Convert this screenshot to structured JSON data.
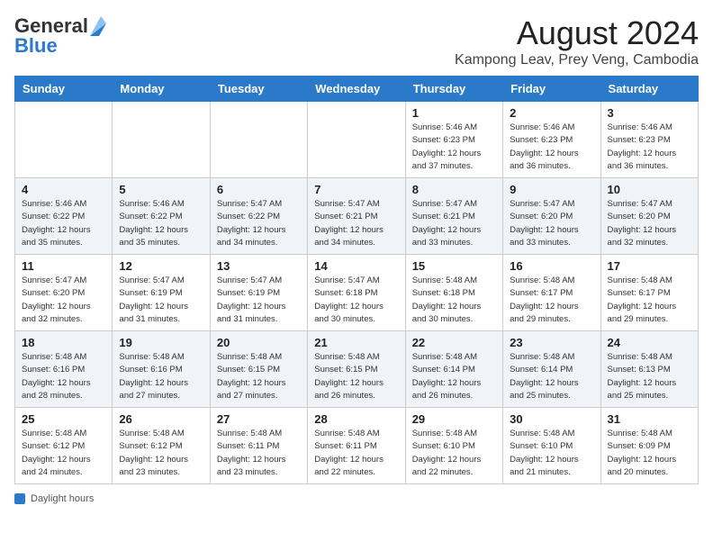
{
  "header": {
    "logo_general": "General",
    "logo_blue": "Blue",
    "month_title": "August 2024",
    "location": "Kampong Leav, Prey Veng, Cambodia"
  },
  "days_of_week": [
    "Sunday",
    "Monday",
    "Tuesday",
    "Wednesday",
    "Thursday",
    "Friday",
    "Saturday"
  ],
  "weeks": [
    [
      {
        "day": "",
        "info": ""
      },
      {
        "day": "",
        "info": ""
      },
      {
        "day": "",
        "info": ""
      },
      {
        "day": "",
        "info": ""
      },
      {
        "day": "1",
        "info": "Sunrise: 5:46 AM\nSunset: 6:23 PM\nDaylight: 12 hours\nand 37 minutes."
      },
      {
        "day": "2",
        "info": "Sunrise: 5:46 AM\nSunset: 6:23 PM\nDaylight: 12 hours\nand 36 minutes."
      },
      {
        "day": "3",
        "info": "Sunrise: 5:46 AM\nSunset: 6:23 PM\nDaylight: 12 hours\nand 36 minutes."
      }
    ],
    [
      {
        "day": "4",
        "info": "Sunrise: 5:46 AM\nSunset: 6:22 PM\nDaylight: 12 hours\nand 35 minutes."
      },
      {
        "day": "5",
        "info": "Sunrise: 5:46 AM\nSunset: 6:22 PM\nDaylight: 12 hours\nand 35 minutes."
      },
      {
        "day": "6",
        "info": "Sunrise: 5:47 AM\nSunset: 6:22 PM\nDaylight: 12 hours\nand 34 minutes."
      },
      {
        "day": "7",
        "info": "Sunrise: 5:47 AM\nSunset: 6:21 PM\nDaylight: 12 hours\nand 34 minutes."
      },
      {
        "day": "8",
        "info": "Sunrise: 5:47 AM\nSunset: 6:21 PM\nDaylight: 12 hours\nand 33 minutes."
      },
      {
        "day": "9",
        "info": "Sunrise: 5:47 AM\nSunset: 6:20 PM\nDaylight: 12 hours\nand 33 minutes."
      },
      {
        "day": "10",
        "info": "Sunrise: 5:47 AM\nSunset: 6:20 PM\nDaylight: 12 hours\nand 32 minutes."
      }
    ],
    [
      {
        "day": "11",
        "info": "Sunrise: 5:47 AM\nSunset: 6:20 PM\nDaylight: 12 hours\nand 32 minutes."
      },
      {
        "day": "12",
        "info": "Sunrise: 5:47 AM\nSunset: 6:19 PM\nDaylight: 12 hours\nand 31 minutes."
      },
      {
        "day": "13",
        "info": "Sunrise: 5:47 AM\nSunset: 6:19 PM\nDaylight: 12 hours\nand 31 minutes."
      },
      {
        "day": "14",
        "info": "Sunrise: 5:47 AM\nSunset: 6:18 PM\nDaylight: 12 hours\nand 30 minutes."
      },
      {
        "day": "15",
        "info": "Sunrise: 5:48 AM\nSunset: 6:18 PM\nDaylight: 12 hours\nand 30 minutes."
      },
      {
        "day": "16",
        "info": "Sunrise: 5:48 AM\nSunset: 6:17 PM\nDaylight: 12 hours\nand 29 minutes."
      },
      {
        "day": "17",
        "info": "Sunrise: 5:48 AM\nSunset: 6:17 PM\nDaylight: 12 hours\nand 29 minutes."
      }
    ],
    [
      {
        "day": "18",
        "info": "Sunrise: 5:48 AM\nSunset: 6:16 PM\nDaylight: 12 hours\nand 28 minutes."
      },
      {
        "day": "19",
        "info": "Sunrise: 5:48 AM\nSunset: 6:16 PM\nDaylight: 12 hours\nand 27 minutes."
      },
      {
        "day": "20",
        "info": "Sunrise: 5:48 AM\nSunset: 6:15 PM\nDaylight: 12 hours\nand 27 minutes."
      },
      {
        "day": "21",
        "info": "Sunrise: 5:48 AM\nSunset: 6:15 PM\nDaylight: 12 hours\nand 26 minutes."
      },
      {
        "day": "22",
        "info": "Sunrise: 5:48 AM\nSunset: 6:14 PM\nDaylight: 12 hours\nand 26 minutes."
      },
      {
        "day": "23",
        "info": "Sunrise: 5:48 AM\nSunset: 6:14 PM\nDaylight: 12 hours\nand 25 minutes."
      },
      {
        "day": "24",
        "info": "Sunrise: 5:48 AM\nSunset: 6:13 PM\nDaylight: 12 hours\nand 25 minutes."
      }
    ],
    [
      {
        "day": "25",
        "info": "Sunrise: 5:48 AM\nSunset: 6:12 PM\nDaylight: 12 hours\nand 24 minutes."
      },
      {
        "day": "26",
        "info": "Sunrise: 5:48 AM\nSunset: 6:12 PM\nDaylight: 12 hours\nand 23 minutes."
      },
      {
        "day": "27",
        "info": "Sunrise: 5:48 AM\nSunset: 6:11 PM\nDaylight: 12 hours\nand 23 minutes."
      },
      {
        "day": "28",
        "info": "Sunrise: 5:48 AM\nSunset: 6:11 PM\nDaylight: 12 hours\nand 22 minutes."
      },
      {
        "day": "29",
        "info": "Sunrise: 5:48 AM\nSunset: 6:10 PM\nDaylight: 12 hours\nand 22 minutes."
      },
      {
        "day": "30",
        "info": "Sunrise: 5:48 AM\nSunset: 6:10 PM\nDaylight: 12 hours\nand 21 minutes."
      },
      {
        "day": "31",
        "info": "Sunrise: 5:48 AM\nSunset: 6:09 PM\nDaylight: 12 hours\nand 20 minutes."
      }
    ]
  ],
  "footer": {
    "daylight_label": "Daylight hours"
  }
}
